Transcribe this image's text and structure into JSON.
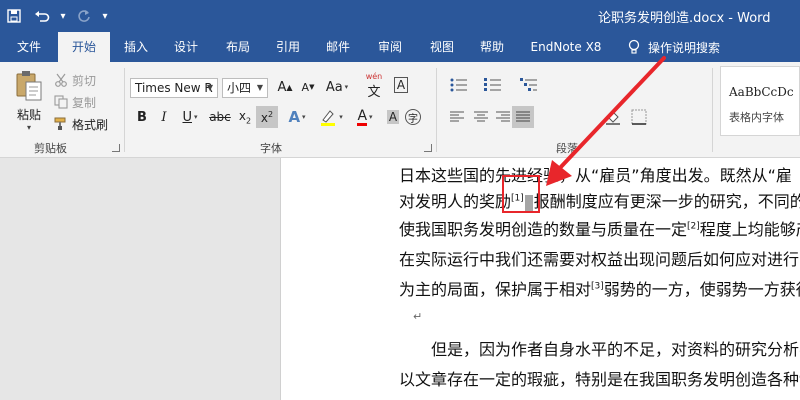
{
  "titlebar": {
    "title": "论职务发明创造.docx  -  Word"
  },
  "tabs": [
    {
      "label": "文件"
    },
    {
      "label": "开始"
    },
    {
      "label": "插入"
    },
    {
      "label": "设计"
    },
    {
      "label": "布局"
    },
    {
      "label": "引用"
    },
    {
      "label": "邮件"
    },
    {
      "label": "审阅"
    },
    {
      "label": "视图"
    },
    {
      "label": "帮助"
    },
    {
      "label": "EndNote X8"
    }
  ],
  "tell_me": {
    "label": "操作说明搜索"
  },
  "clipboard": {
    "paste": "粘贴",
    "cut": "剪切",
    "copy": "复制",
    "format_painter": "格式刷",
    "group_label": "剪贴板"
  },
  "font": {
    "font_name": "Times New R",
    "font_size": "小四",
    "grow_label": "A",
    "shrink_label": "A",
    "case_label": "Aa",
    "phonetic_label": "wén",
    "group_label": "字体"
  },
  "paragraph": {
    "group_label": "段落"
  },
  "styles": {
    "preview": "AaBbCcDc",
    "name": "表格内字体"
  },
  "document": {
    "line1": "日本这些国的先进经验，从“雇员”角度出发。既然从“雇",
    "line2a": "对发明人的奖励",
    "line2_sup": "[1]",
    "line2b": "报酬制度应有更深一步的研究，不同的",
    "line3a": "使我国职务发明创造的数量与质量在一定",
    "line3_sup": "[2]",
    "line3b": "程度上均能够产",
    "line4": "在实际运行中我们还需要对权益出现问题后如何应对进行",
    "line5a": "为主的局面，保护属于相对",
    "line5_sup": "[3]",
    "line5b": "弱势的一方，使弱势一方获得",
    "para_mark": "↵",
    "line6": "但是，因为作者自身水平的不足，对资料的研究分析不",
    "line7": "以文章存在一定的瑕疵，特别是在我国职务发明创造各种制"
  }
}
